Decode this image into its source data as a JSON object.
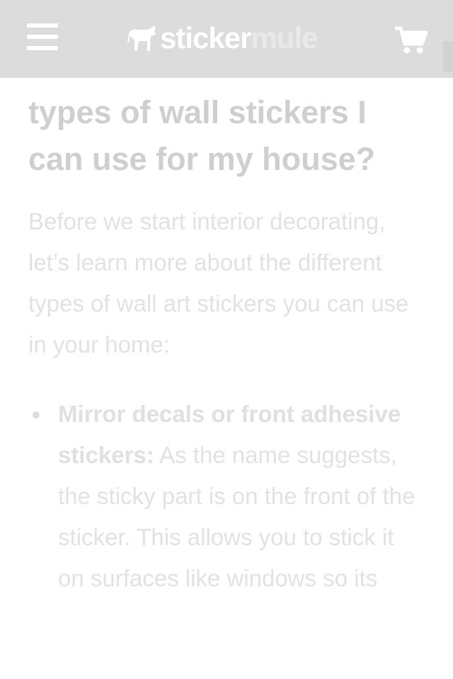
{
  "header": {
    "menu_icon": "hamburger-menu-icon",
    "logo": {
      "part1": "sticker",
      "part2": "mule",
      "icon": "mule-icon"
    },
    "cart_icon": "shopping-cart-icon",
    "background": "#dcdcdc"
  },
  "article": {
    "heading": "What are the different types of wall stickers I can use for my house?",
    "intro": "Before we start interior decorating, let’s learn more about the different types of wall art stickers you can use in your home:",
    "bullets": [
      {
        "bold": "Mirror decals or front adhesive stickers:",
        "text": " As the name suggests, the sticky part is on the front of the sticker. This allows you to stick it on surfaces like windows so its"
      }
    ]
  },
  "colors": {
    "heading_text": "#cfcfcf",
    "body_text": "#e2e2e2",
    "header_bg": "#dcdcdc"
  }
}
